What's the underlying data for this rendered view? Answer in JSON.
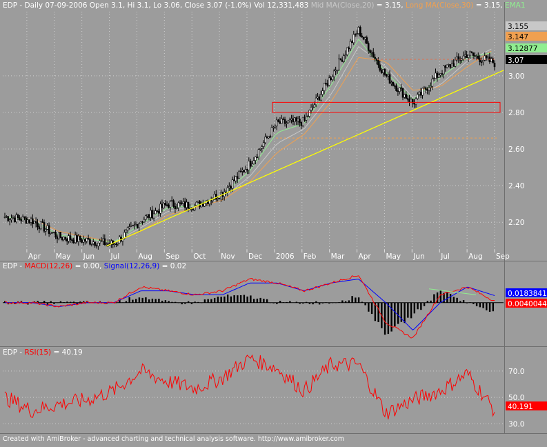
{
  "price_panel": {
    "title_parts": [
      {
        "text": "EDP - Daily 07-09-2006 Open 3.1, Hi 3.1, Lo 3.06, Close 3.07 (-1.0%) Vol 12,331,483 ",
        "color": "#ffffff"
      },
      {
        "text": "Mid MA(Close,20)",
        "color": "#c8c8c8"
      },
      {
        "text": " = 3.15, ",
        "color": "#ffffff"
      },
      {
        "text": "Long MA(Close,30)",
        "color": "#f0a050"
      },
      {
        "text": " = 3.15, ",
        "color": "#ffffff"
      },
      {
        "text": "EMA1",
        "color": "#90ee90"
      }
    ],
    "y_ticks": [
      "3.00",
      "2.80",
      "2.60",
      "2.40",
      "2.20"
    ],
    "x_labels": [
      "Apr",
      "May",
      "Jun",
      "Jul",
      "Aug",
      "Sep",
      "Oct",
      "Nov",
      "Dec",
      "2006",
      "Feb",
      "Mar",
      "Apr",
      "May",
      "Jun",
      "Jul",
      "Aug",
      "Sep"
    ],
    "value_tags": [
      {
        "text": "3.155",
        "bg": "#c8c8c8",
        "fg": "#000000"
      },
      {
        "text": "3.147",
        "bg": "#f0a050",
        "fg": "#000000"
      },
      {
        "text": "3.12877",
        "bg": "#90ee90",
        "fg": "#000000"
      },
      {
        "text": "3.07",
        "bg": "#000000",
        "fg": "#ffffff"
      }
    ]
  },
  "macd_panel": {
    "title_parts": [
      {
        "text": "EDP - ",
        "color": "#ffffff"
      },
      {
        "text": "MACD(12,26)",
        "color": "#ff0000"
      },
      {
        "text": " = 0.00, ",
        "color": "#ffffff"
      },
      {
        "text": "Signal(12,26,9)",
        "color": "#0000ff"
      },
      {
        "text": " = 0.02",
        "color": "#ffffff"
      }
    ],
    "value_tags": [
      {
        "text": "0.0183841",
        "bg": "#0000ff",
        "fg": "#ffffff"
      },
      {
        "text": "0.0040044",
        "bg": "#ff0000",
        "fg": "#ffffff"
      }
    ]
  },
  "rsi_panel": {
    "title_parts": [
      {
        "text": "EDP - ",
        "color": "#ffffff"
      },
      {
        "text": "RSI(15)",
        "color": "#ff0000"
      },
      {
        "text": " = 40.19",
        "color": "#ffffff"
      }
    ],
    "y_ticks": [
      "70.0",
      "50.0",
      "30.0"
    ],
    "value_tags": [
      {
        "text": "40.191",
        "bg": "#ff0000",
        "fg": "#ffffff"
      }
    ]
  },
  "footer": {
    "credit": "Created with AmiBroker - advanced charting and technical analysis software. http://www.amibroker.com"
  },
  "colors": {
    "background": "#9c9c9c",
    "grid": "#d0d0d0",
    "candle": "#000000",
    "ema": "#90ee90",
    "mid_ma": "#c8c8c8",
    "long_ma": "#f0a050",
    "trendline": "#ffff00",
    "box": "#ff0000",
    "macd": "#ff0000",
    "signal": "#0000ff",
    "rsi": "#ff0000"
  },
  "chart_data": [
    {
      "type": "line",
      "subtype": "candlestick-approximated",
      "title": "EDP - Daily 07-09-2006",
      "x": [
        "2005-03",
        "2005-04",
        "2005-05",
        "2005-06",
        "2005-07",
        "2005-08",
        "2005-09",
        "2005-10",
        "2005-11",
        "2005-12",
        "2006-01",
        "2006-02",
        "2006-03",
        "2006-04",
        "2006-05",
        "2006-06",
        "2006-07",
        "2006-08",
        "2006-09"
      ],
      "series": [
        {
          "name": "Close",
          "values": [
            2.23,
            2.21,
            2.12,
            2.1,
            2.08,
            2.21,
            2.3,
            2.29,
            2.36,
            2.52,
            2.74,
            2.75,
            3.0,
            3.25,
            3.0,
            2.85,
            3.02,
            3.12,
            3.07
          ]
        },
        {
          "name": "Mid MA(Close,20)",
          "values": [
            2.23,
            2.22,
            2.14,
            2.11,
            2.09,
            2.17,
            2.26,
            2.29,
            2.33,
            2.45,
            2.63,
            2.71,
            2.9,
            3.16,
            3.05,
            2.88,
            2.95,
            3.08,
            3.155
          ]
        },
        {
          "name": "Long MA(Close,30)",
          "values": [
            2.23,
            2.22,
            2.15,
            2.12,
            2.09,
            2.15,
            2.24,
            2.28,
            2.32,
            2.42,
            2.58,
            2.68,
            2.86,
            3.1,
            3.08,
            2.92,
            2.94,
            3.05,
            3.147
          ]
        },
        {
          "name": "EMA1",
          "values": [
            2.23,
            2.21,
            2.13,
            2.11,
            2.09,
            2.19,
            2.28,
            2.29,
            2.35,
            2.48,
            2.69,
            2.74,
            2.95,
            3.2,
            3.02,
            2.87,
            2.99,
            3.1,
            3.12877
          ]
        }
      ],
      "ylim": [
        2.05,
        3.35
      ],
      "y_ticks": [
        3.0,
        2.8,
        2.6,
        2.4,
        2.2
      ],
      "grid": true,
      "value_tags": [
        3.155,
        3.147,
        3.12877,
        3.07
      ]
    },
    {
      "type": "line",
      "title": "EDP - MACD(12,26) = 0.00, Signal(12,26,9) = 0.02",
      "x": [
        "2005-03",
        "2005-04",
        "2005-05",
        "2005-06",
        "2005-07",
        "2005-08",
        "2005-09",
        "2005-10",
        "2005-11",
        "2005-12",
        "2006-01",
        "2006-02",
        "2006-03",
        "2006-04",
        "2006-05",
        "2006-06",
        "2006-07",
        "2006-08",
        "2006-09"
      ],
      "series": [
        {
          "name": "MACD(12,26)",
          "values": [
            0.0,
            0.0,
            -0.01,
            0.0,
            0.0,
            0.04,
            0.03,
            0.02,
            0.03,
            0.06,
            0.05,
            0.03,
            0.05,
            0.07,
            -0.05,
            -0.09,
            0.02,
            0.04,
            0.004
          ]
        },
        {
          "name": "Signal(12,26,9)",
          "values": [
            0.0,
            0.0,
            -0.01,
            0.0,
            0.0,
            0.03,
            0.03,
            0.02,
            0.02,
            0.05,
            0.05,
            0.03,
            0.05,
            0.06,
            0.0,
            -0.07,
            0.0,
            0.04,
            0.018
          ]
        }
      ],
      "ylim": [
        -0.1,
        0.08
      ],
      "value_tags": [
        0.0183841,
        0.0040044
      ]
    },
    {
      "type": "line",
      "title": "EDP - RSI(15) = 40.19",
      "x": [
        "2005-03",
        "2005-04",
        "2005-05",
        "2005-06",
        "2005-07",
        "2005-08",
        "2005-09",
        "2005-10",
        "2005-11",
        "2005-12",
        "2006-01",
        "2006-02",
        "2006-03",
        "2006-04",
        "2006-05",
        "2006-06",
        "2006-07",
        "2006-08",
        "2006-09"
      ],
      "series": [
        {
          "name": "RSI(15)",
          "values": [
            50,
            40,
            45,
            48,
            55,
            70,
            62,
            57,
            65,
            80,
            72,
            55,
            75,
            75,
            38,
            48,
            55,
            68,
            40.19
          ]
        }
      ],
      "ylim": [
        25,
        83
      ],
      "y_ticks": [
        70,
        50,
        30
      ],
      "value_tags": [
        40.191
      ]
    }
  ]
}
